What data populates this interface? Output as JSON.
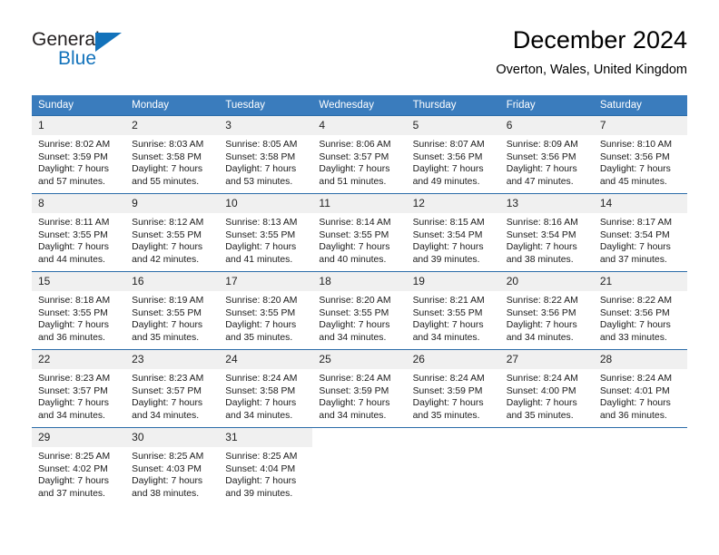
{
  "brand": {
    "name_top": "General",
    "name_bottom": "Blue",
    "logo_icon": "triangle-icon",
    "accent_color": "#1272bb"
  },
  "header": {
    "title": "December 2024",
    "subtitle": "Overton, Wales, United Kingdom"
  },
  "calendar": {
    "header_color": "#3a7cbd",
    "daynum_background": "#f0f0f0",
    "weekday_headers": [
      "Sunday",
      "Monday",
      "Tuesday",
      "Wednesday",
      "Thursday",
      "Friday",
      "Saturday"
    ],
    "weeks": [
      [
        {
          "day": "1",
          "sunrise": "Sunrise: 8:02 AM",
          "sunset": "Sunset: 3:59 PM",
          "daylight_line1": "Daylight: 7 hours",
          "daylight_line2": "and 57 minutes."
        },
        {
          "day": "2",
          "sunrise": "Sunrise: 8:03 AM",
          "sunset": "Sunset: 3:58 PM",
          "daylight_line1": "Daylight: 7 hours",
          "daylight_line2": "and 55 minutes."
        },
        {
          "day": "3",
          "sunrise": "Sunrise: 8:05 AM",
          "sunset": "Sunset: 3:58 PM",
          "daylight_line1": "Daylight: 7 hours",
          "daylight_line2": "and 53 minutes."
        },
        {
          "day": "4",
          "sunrise": "Sunrise: 8:06 AM",
          "sunset": "Sunset: 3:57 PM",
          "daylight_line1": "Daylight: 7 hours",
          "daylight_line2": "and 51 minutes."
        },
        {
          "day": "5",
          "sunrise": "Sunrise: 8:07 AM",
          "sunset": "Sunset: 3:56 PM",
          "daylight_line1": "Daylight: 7 hours",
          "daylight_line2": "and 49 minutes."
        },
        {
          "day": "6",
          "sunrise": "Sunrise: 8:09 AM",
          "sunset": "Sunset: 3:56 PM",
          "daylight_line1": "Daylight: 7 hours",
          "daylight_line2": "and 47 minutes."
        },
        {
          "day": "7",
          "sunrise": "Sunrise: 8:10 AM",
          "sunset": "Sunset: 3:56 PM",
          "daylight_line1": "Daylight: 7 hours",
          "daylight_line2": "and 45 minutes."
        }
      ],
      [
        {
          "day": "8",
          "sunrise": "Sunrise: 8:11 AM",
          "sunset": "Sunset: 3:55 PM",
          "daylight_line1": "Daylight: 7 hours",
          "daylight_line2": "and 44 minutes."
        },
        {
          "day": "9",
          "sunrise": "Sunrise: 8:12 AM",
          "sunset": "Sunset: 3:55 PM",
          "daylight_line1": "Daylight: 7 hours",
          "daylight_line2": "and 42 minutes."
        },
        {
          "day": "10",
          "sunrise": "Sunrise: 8:13 AM",
          "sunset": "Sunset: 3:55 PM",
          "daylight_line1": "Daylight: 7 hours",
          "daylight_line2": "and 41 minutes."
        },
        {
          "day": "11",
          "sunrise": "Sunrise: 8:14 AM",
          "sunset": "Sunset: 3:55 PM",
          "daylight_line1": "Daylight: 7 hours",
          "daylight_line2": "and 40 minutes."
        },
        {
          "day": "12",
          "sunrise": "Sunrise: 8:15 AM",
          "sunset": "Sunset: 3:54 PM",
          "daylight_line1": "Daylight: 7 hours",
          "daylight_line2": "and 39 minutes."
        },
        {
          "day": "13",
          "sunrise": "Sunrise: 8:16 AM",
          "sunset": "Sunset: 3:54 PM",
          "daylight_line1": "Daylight: 7 hours",
          "daylight_line2": "and 38 minutes."
        },
        {
          "day": "14",
          "sunrise": "Sunrise: 8:17 AM",
          "sunset": "Sunset: 3:54 PM",
          "daylight_line1": "Daylight: 7 hours",
          "daylight_line2": "and 37 minutes."
        }
      ],
      [
        {
          "day": "15",
          "sunrise": "Sunrise: 8:18 AM",
          "sunset": "Sunset: 3:55 PM",
          "daylight_line1": "Daylight: 7 hours",
          "daylight_line2": "and 36 minutes."
        },
        {
          "day": "16",
          "sunrise": "Sunrise: 8:19 AM",
          "sunset": "Sunset: 3:55 PM",
          "daylight_line1": "Daylight: 7 hours",
          "daylight_line2": "and 35 minutes."
        },
        {
          "day": "17",
          "sunrise": "Sunrise: 8:20 AM",
          "sunset": "Sunset: 3:55 PM",
          "daylight_line1": "Daylight: 7 hours",
          "daylight_line2": "and 35 minutes."
        },
        {
          "day": "18",
          "sunrise": "Sunrise: 8:20 AM",
          "sunset": "Sunset: 3:55 PM",
          "daylight_line1": "Daylight: 7 hours",
          "daylight_line2": "and 34 minutes."
        },
        {
          "day": "19",
          "sunrise": "Sunrise: 8:21 AM",
          "sunset": "Sunset: 3:55 PM",
          "daylight_line1": "Daylight: 7 hours",
          "daylight_line2": "and 34 minutes."
        },
        {
          "day": "20",
          "sunrise": "Sunrise: 8:22 AM",
          "sunset": "Sunset: 3:56 PM",
          "daylight_line1": "Daylight: 7 hours",
          "daylight_line2": "and 34 minutes."
        },
        {
          "day": "21",
          "sunrise": "Sunrise: 8:22 AM",
          "sunset": "Sunset: 3:56 PM",
          "daylight_line1": "Daylight: 7 hours",
          "daylight_line2": "and 33 minutes."
        }
      ],
      [
        {
          "day": "22",
          "sunrise": "Sunrise: 8:23 AM",
          "sunset": "Sunset: 3:57 PM",
          "daylight_line1": "Daylight: 7 hours",
          "daylight_line2": "and 34 minutes."
        },
        {
          "day": "23",
          "sunrise": "Sunrise: 8:23 AM",
          "sunset": "Sunset: 3:57 PM",
          "daylight_line1": "Daylight: 7 hours",
          "daylight_line2": "and 34 minutes."
        },
        {
          "day": "24",
          "sunrise": "Sunrise: 8:24 AM",
          "sunset": "Sunset: 3:58 PM",
          "daylight_line1": "Daylight: 7 hours",
          "daylight_line2": "and 34 minutes."
        },
        {
          "day": "25",
          "sunrise": "Sunrise: 8:24 AM",
          "sunset": "Sunset: 3:59 PM",
          "daylight_line1": "Daylight: 7 hours",
          "daylight_line2": "and 34 minutes."
        },
        {
          "day": "26",
          "sunrise": "Sunrise: 8:24 AM",
          "sunset": "Sunset: 3:59 PM",
          "daylight_line1": "Daylight: 7 hours",
          "daylight_line2": "and 35 minutes."
        },
        {
          "day": "27",
          "sunrise": "Sunrise: 8:24 AM",
          "sunset": "Sunset: 4:00 PM",
          "daylight_line1": "Daylight: 7 hours",
          "daylight_line2": "and 35 minutes."
        },
        {
          "day": "28",
          "sunrise": "Sunrise: 8:24 AM",
          "sunset": "Sunset: 4:01 PM",
          "daylight_line1": "Daylight: 7 hours",
          "daylight_line2": "and 36 minutes."
        }
      ],
      [
        {
          "day": "29",
          "sunrise": "Sunrise: 8:25 AM",
          "sunset": "Sunset: 4:02 PM",
          "daylight_line1": "Daylight: 7 hours",
          "daylight_line2": "and 37 minutes."
        },
        {
          "day": "30",
          "sunrise": "Sunrise: 8:25 AM",
          "sunset": "Sunset: 4:03 PM",
          "daylight_line1": "Daylight: 7 hours",
          "daylight_line2": "and 38 minutes."
        },
        {
          "day": "31",
          "sunrise": "Sunrise: 8:25 AM",
          "sunset": "Sunset: 4:04 PM",
          "daylight_line1": "Daylight: 7 hours",
          "daylight_line2": "and 39 minutes."
        },
        {
          "day": "",
          "sunrise": "",
          "sunset": "",
          "daylight_line1": "",
          "daylight_line2": ""
        },
        {
          "day": "",
          "sunrise": "",
          "sunset": "",
          "daylight_line1": "",
          "daylight_line2": ""
        },
        {
          "day": "",
          "sunrise": "",
          "sunset": "",
          "daylight_line1": "",
          "daylight_line2": ""
        },
        {
          "day": "",
          "sunrise": "",
          "sunset": "",
          "daylight_line1": "",
          "daylight_line2": ""
        }
      ]
    ]
  }
}
